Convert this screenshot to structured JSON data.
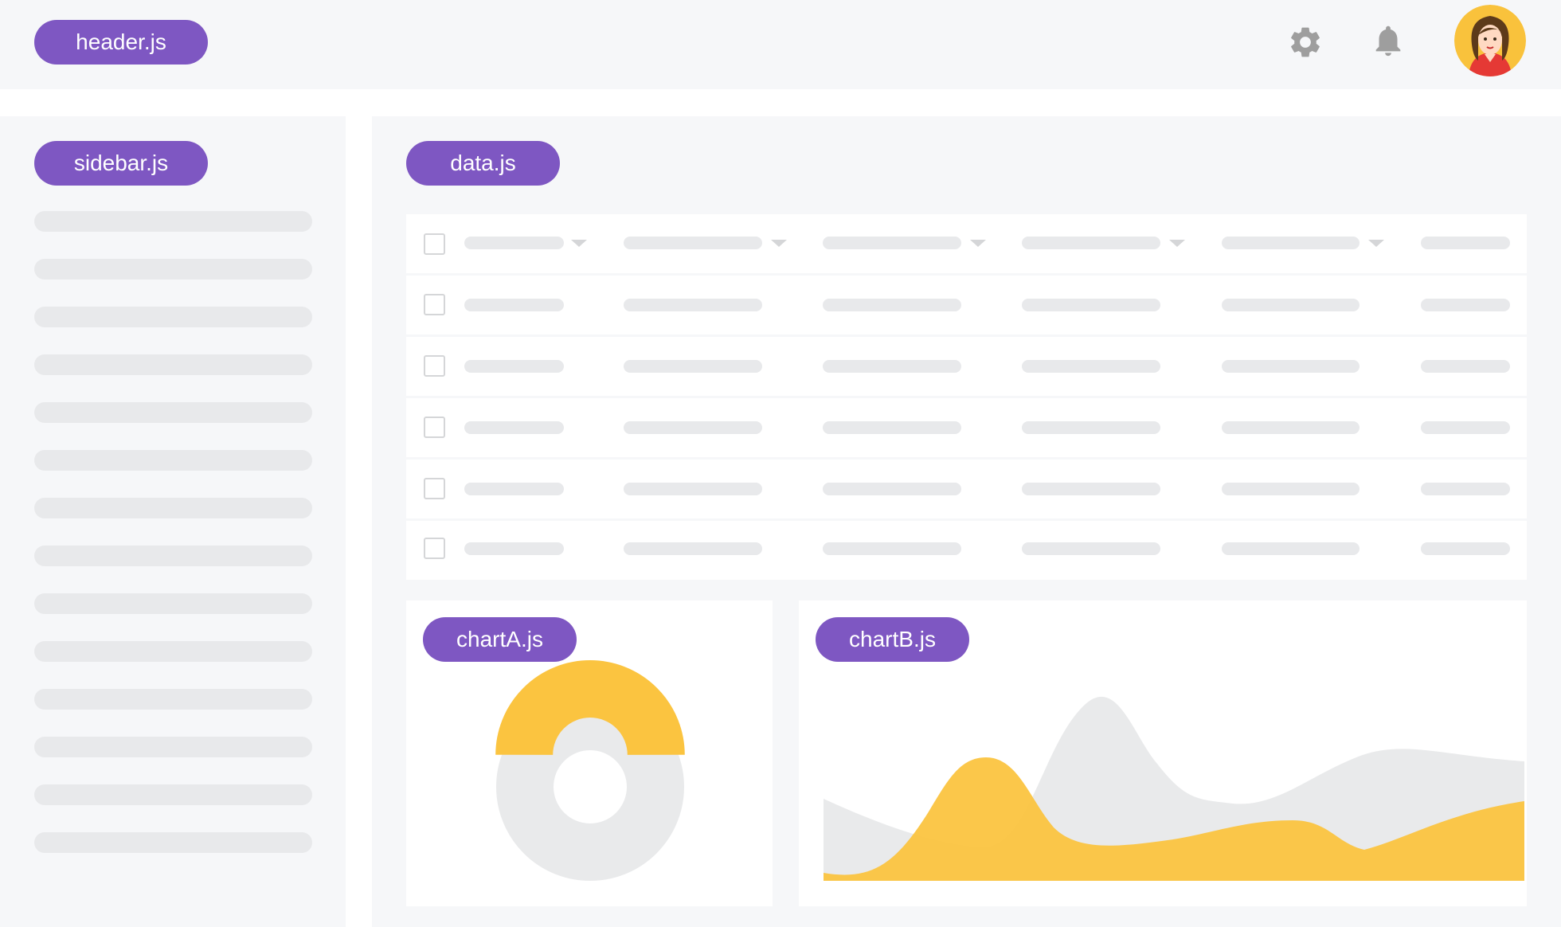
{
  "header": {
    "label": "header.js"
  },
  "sidebar": {
    "label": "sidebar.js"
  },
  "data": {
    "label": "data.js"
  },
  "chartA": {
    "label": "chartA.js"
  },
  "chartB": {
    "label": "chartB.js"
  },
  "colors": {
    "accent": "#7e57c2",
    "chart_primary": "#fbc440",
    "chart_secondary": "#e9eaeb",
    "placeholder": "#e8e9eb"
  },
  "icons": {
    "settings": "gear-icon",
    "notifications": "bell-icon",
    "user": "avatar"
  }
}
